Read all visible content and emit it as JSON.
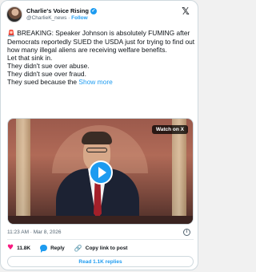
{
  "post": {
    "display_name": "Charlie's Voice Rising",
    "handle": "@CharlieK_news",
    "separator": "·",
    "follow_label": "Follow",
    "verified_icon": "verified-badge-icon",
    "siren_icon": "🚨",
    "paragraphs": [
      "BREAKING: Speaker Johnson is absolutely FUMING after Democrats reportedly SUED the USDA just for trying to find out how many illegal aliens are receiving welfare benefits.",
      "Let that sink in.",
      "They didn't sue over abuse.",
      "They didn't sue over fraud.",
      "They sued because the"
    ],
    "show_more": "Show more",
    "timestamp": "11:23 AM · Mar 8, 2026"
  },
  "video": {
    "watch_label": "Watch on X"
  },
  "actions": {
    "like_count": "11.8K",
    "reply_label": "Reply",
    "copy_link_label": "Copy link to post"
  },
  "footer": {
    "read_replies_label": "Read 1.1K replies"
  },
  "colors": {
    "accent": "#1d9bf0",
    "like": "#f91880",
    "text": "#0f1419",
    "muted": "#536471"
  }
}
